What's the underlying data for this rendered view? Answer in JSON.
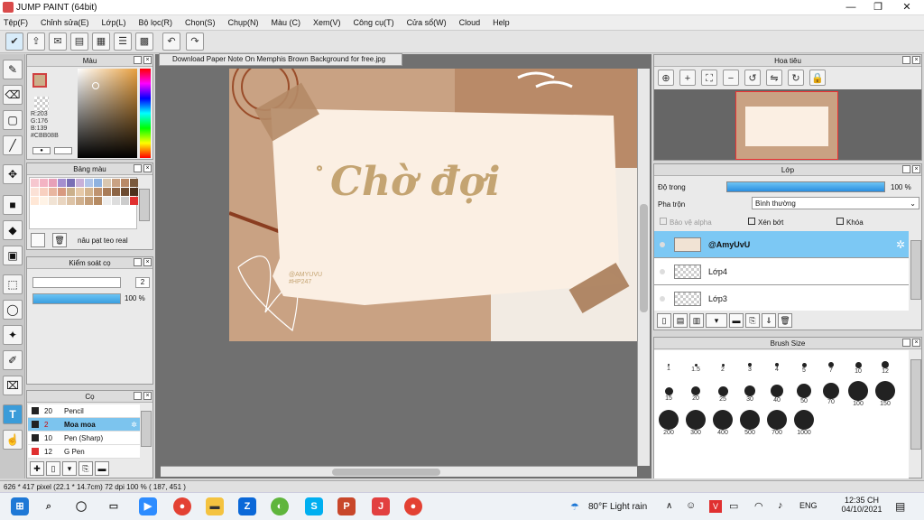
{
  "window": {
    "title": "JUMP PAINT (64bit)",
    "minimize": "—",
    "maximize": "❐",
    "close": "✕"
  },
  "menu": [
    "Tệp(F)",
    "Chỉnh sửa(E)",
    "Lớp(L)",
    "Bộ lọc(R)",
    "Chọn(S)",
    "Chụp(N)",
    "Màu (C)",
    "Xem(V)",
    "Công cụ(T)",
    "Cửa sổ(W)",
    "Cloud",
    "Help"
  ],
  "color_panel": {
    "title": "Màu",
    "rgb": [
      "R:203",
      "G:176",
      "B:139"
    ],
    "hex": "#CBB08B",
    "fg_color": "#CBB08B"
  },
  "palette_panel": {
    "title": "Bảng màu",
    "name": "nâu pạt teo real"
  },
  "control_panel": {
    "title": "Kiểm soát cọ",
    "size_value": "2",
    "opacity": "100 %"
  },
  "brush_panel": {
    "title": "Cọ",
    "items": [
      {
        "size": "20",
        "name": "Pencil",
        "color": "#222222"
      },
      {
        "size": "2",
        "name": "Moa moa",
        "color": "#222222"
      },
      {
        "size": "10",
        "name": "Pen (Sharp)",
        "color": "#222222"
      },
      {
        "size": "12",
        "name": "G Pen",
        "color": "#e03030"
      }
    ]
  },
  "document": {
    "tab": "Download Paper Note On Memphis Brown Background for free.jpg",
    "art_title": "Chờ đợi",
    "art_sign": "@AMYUVU",
    "art_sign2": "#HP247"
  },
  "navigator": {
    "title": "Hoa tiêu"
  },
  "layer_panel": {
    "title": "Lớp",
    "opacity_label": "Độ trong",
    "opacity_value": "100 %",
    "blend_label": "Pha trộn",
    "blend_value": "Bình thường",
    "protect_alpha": "Bảo vệ alpha",
    "clipping": "Xén bớt",
    "lock": "Khóa",
    "layers": [
      "@AmyUvU",
      "Lớp4",
      "Lớp3"
    ]
  },
  "brush_size": {
    "title": "Brush Size",
    "sizes": [
      "1",
      "1.5",
      "2",
      "3",
      "4",
      "5",
      "7",
      "10",
      "12",
      "15",
      "20",
      "25",
      "30",
      "40",
      "50",
      "70",
      "100",
      "150",
      "200",
      "300",
      "400",
      "500",
      "700",
      "1000"
    ]
  },
  "status": {
    "text": "626 * 417 pixel   (22.1 * 14.7cm)   72 dpi   100 %   ( 187, 451 )"
  },
  "taskbar": {
    "weather": "80°F  Light rain",
    "lang": "ENG",
    "time": "12:35 CH",
    "date": "04/10/2021"
  }
}
